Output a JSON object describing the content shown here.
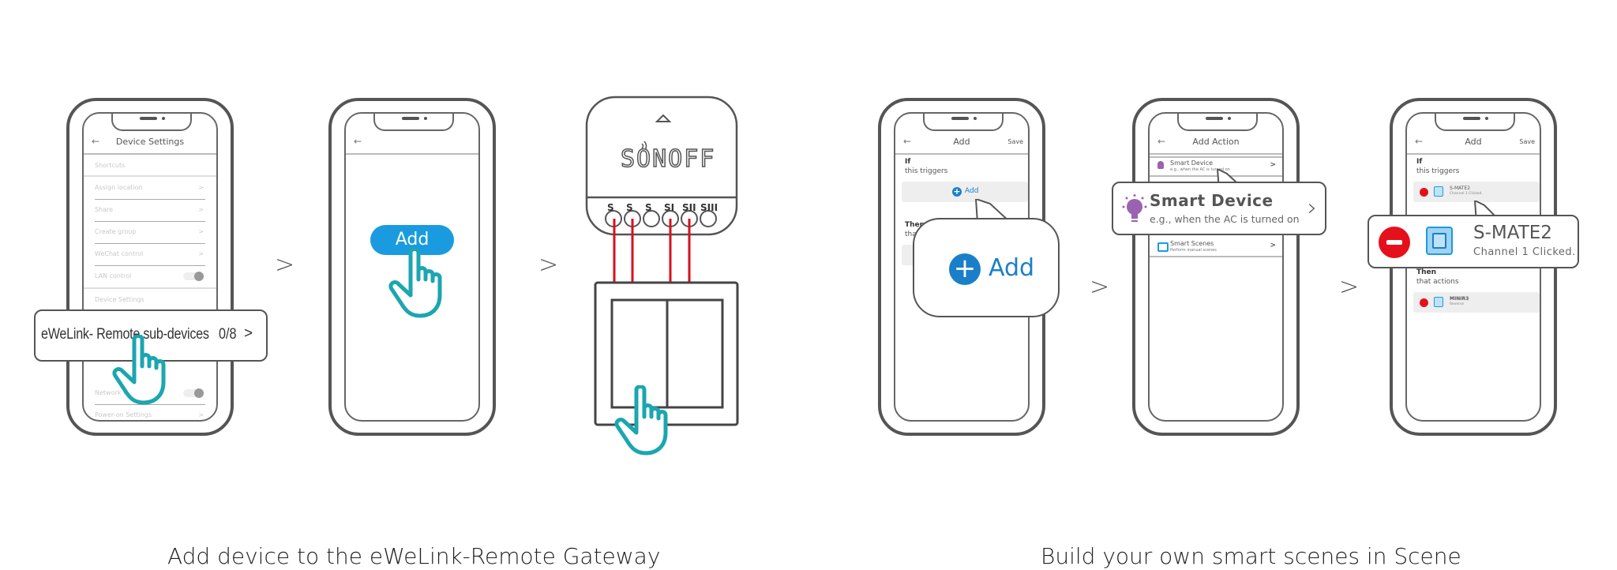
{
  "step1": {
    "header_title": "Device Settings",
    "section_shortcuts": "Shortcuts",
    "rows": [
      {
        "label": "Assign location",
        "chevron": ">"
      },
      {
        "label": "Share",
        "chevron": ">"
      },
      {
        "label": "Create group",
        "chevron": ">"
      },
      {
        "label": "WeChat control",
        "chevron": ">"
      },
      {
        "label": "LAN control",
        "toggle": true
      }
    ],
    "section_device": "Device Settings",
    "rows_lower": [
      {
        "label": "Network i...",
        "toggle": true
      },
      {
        "label": "Power-on Settings",
        "chevron": ">"
      }
    ],
    "callout_label": "eWeLink- Remote sub-devices",
    "callout_count": "0/8",
    "callout_chevron": ">"
  },
  "step2": {
    "add_button_label": "Add"
  },
  "step3": {
    "brand": "SONOFF",
    "terminals": [
      "S",
      "S",
      "S",
      "SΙ",
      "SΙΙ",
      "SΙΙΙ"
    ]
  },
  "step4": {
    "header_title": "Add",
    "save_label": "Save",
    "if_label": "If",
    "if_sub": "this triggers",
    "add_small_label": "Add",
    "then_label": "Then",
    "then_sub": "that actions",
    "callout_add_label": "Add"
  },
  "step5": {
    "header_title": "Add Action",
    "items": [
      {
        "title": "Smart Device",
        "subtitle": "e.g., when the AC is turned on",
        "chevron": ">"
      },
      {
        "title": "Smart Scenes",
        "subtitle": "Perform manual scenes",
        "chevron": ">"
      }
    ],
    "callout_title": "Smart Device",
    "callout_subtitle": "e.g., when the  AC is turned on"
  },
  "step6": {
    "header_title": "Add",
    "save_label": "Save",
    "if_label": "If",
    "if_sub": "this triggers",
    "trigger_name": "S-MATE2",
    "trigger_sub": "Channel 1 Clicked.",
    "then_label": "Then",
    "then_sub": "that actions",
    "action_name": "MINIR3",
    "action_sub": "Reverse",
    "callout_title": "S-MATE2",
    "callout_subtitle": "Channel 1 Clicked."
  },
  "arrows": [
    ">",
    ">",
    ">",
    ">"
  ],
  "captions": {
    "left": "Add device to the eWeLink-Remote Gateway",
    "right": "Build your own smart scenes in Scene"
  },
  "colors": {
    "accent_blue": "#1a9be0",
    "hand_teal": "#1ba6b0",
    "wire_red": "#d6121f",
    "remove_red": "#e5101b",
    "bulb_purple": "#9a62b0"
  }
}
